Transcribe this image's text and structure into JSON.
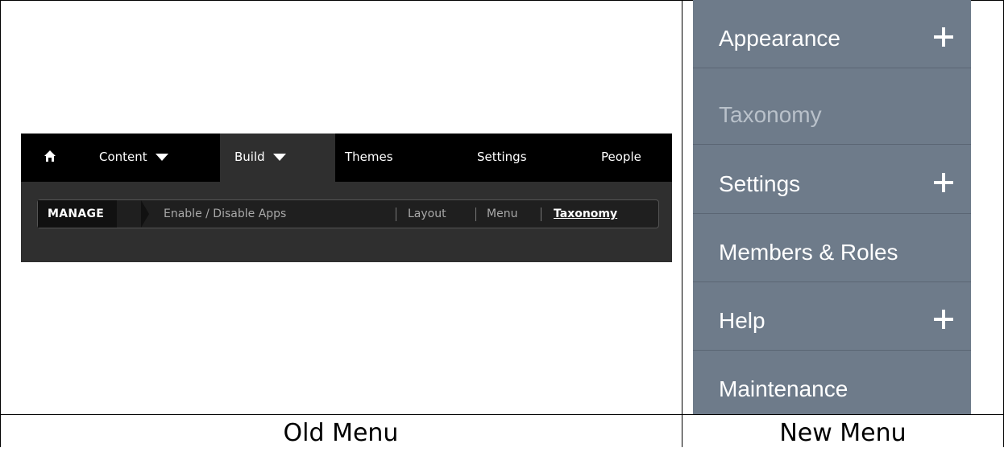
{
  "old_menu": {
    "top_items": [
      "Content",
      "Build",
      "Themes",
      "Settings",
      "People"
    ],
    "manage_label": "MANAGE",
    "sub_items": [
      "Enable / Disable Apps",
      "Layout",
      "Menu",
      "Taxonomy"
    ]
  },
  "new_menu": {
    "items": [
      {
        "label": "Appearance",
        "icon": "plus-icon"
      },
      {
        "label": "Taxonomy"
      },
      {
        "label": "Settings",
        "icon": "plus-icon"
      },
      {
        "label": "Members & Roles"
      },
      {
        "label": "Help",
        "icon": "plus-icon"
      },
      {
        "label": "Maintenance"
      }
    ]
  },
  "captions": {
    "left": "Old Menu",
    "right": "New Menu"
  },
  "colors": {
    "old_topbar": "#000000",
    "old_active": "#2f2f2f",
    "new_menu_bg": "#6e7b8a"
  }
}
